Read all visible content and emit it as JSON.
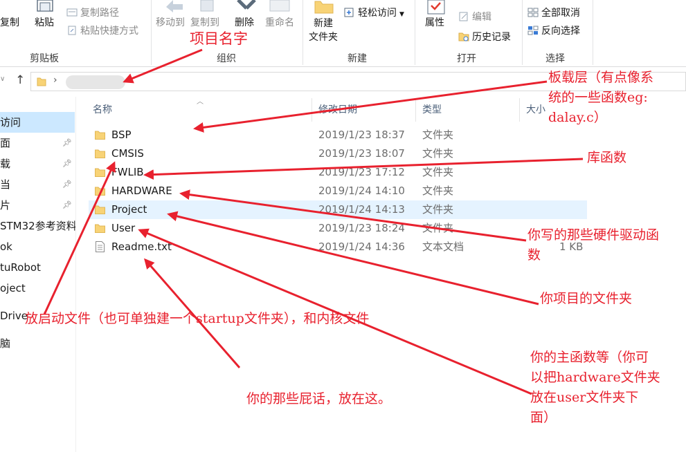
{
  "ribbon": {
    "clipboard": {
      "copy_label": "复制",
      "paste_label": "粘贴",
      "copy_path_label": "复制路径",
      "paste_shortcut_label": "粘贴快捷方式",
      "group_label": "剪贴板"
    },
    "organize": {
      "move_to_label": "移动到",
      "copy_to_label": "复制到",
      "delete_label": "删除",
      "rename_label": "重命名",
      "group_label": "组织"
    },
    "new": {
      "new_folder_label": "新建\n文件夹",
      "easy_access_label": "轻松访问",
      "group_label": "新建"
    },
    "open": {
      "properties_label": "属性",
      "edit_label": "编辑",
      "history_label": "历史记录",
      "group_label": "打开"
    },
    "select": {
      "select_none_label": "全部取消",
      "invert_selection_label": "反向选择",
      "group_label": "选择"
    }
  },
  "nav": {
    "items": [
      {
        "label": "访问",
        "selected": true,
        "pinned": false
      },
      {
        "label": "面",
        "selected": false,
        "pinned": true
      },
      {
        "label": "载",
        "selected": false,
        "pinned": true
      },
      {
        "label": "当",
        "selected": false,
        "pinned": true
      },
      {
        "label": "片",
        "selected": false,
        "pinned": true
      },
      {
        "label": "STM32参考资料",
        "selected": false,
        "pinned": false
      },
      {
        "label": "ok",
        "selected": false,
        "pinned": false
      },
      {
        "label": "tuRobot",
        "selected": false,
        "pinned": false
      },
      {
        "label": "oject",
        "selected": false,
        "pinned": false
      },
      {
        "label": "Drive",
        "selected": false,
        "pinned": false
      },
      {
        "label": "脑",
        "selected": false,
        "pinned": false
      }
    ]
  },
  "columns": {
    "name": "名称",
    "date": "修改日期",
    "type": "类型",
    "size": "大小"
  },
  "files": [
    {
      "name": "BSP",
      "date": "2019/1/23 18:37",
      "type": "文件夹",
      "size": "",
      "kind": "folder"
    },
    {
      "name": "CMSIS",
      "date": "2019/1/23 18:07",
      "type": "文件夹",
      "size": "",
      "kind": "folder"
    },
    {
      "name": "FWLIB",
      "date": "2019/1/23 17:12",
      "type": "文件夹",
      "size": "",
      "kind": "folder"
    },
    {
      "name": "HARDWARE",
      "date": "2019/1/24 14:10",
      "type": "文件夹",
      "size": "",
      "kind": "folder"
    },
    {
      "name": "Project",
      "date": "2019/1/24 14:13",
      "type": "文件夹",
      "size": "",
      "kind": "folder",
      "highlighted": true
    },
    {
      "name": "User",
      "date": "2019/1/23 18:24",
      "type": "文件夹",
      "size": "",
      "kind": "folder"
    },
    {
      "name": "Readme.txt",
      "date": "2019/1/24 14:36",
      "type": "文本文档",
      "size": "1 KB",
      "kind": "text"
    }
  ],
  "annotations": {
    "project_name": "项目名字",
    "bsp_line1": "板载层（有点像系",
    "bsp_line2": "统的一些函数eg:",
    "bsp_line3": "dalay.c）",
    "fwlib": "库函数",
    "hardware_line1": "你写的那些硬件驱动函",
    "hardware_line2": "数",
    "project": "你项目的文件夹",
    "cmsis": "放启动文件（也可单独建一个startup文件夹），和内核文件",
    "user_line1": "你的主函数等（你可",
    "user_line2": "以把hardware文件夹",
    "user_line3": "放在user文件夹下",
    "user_line4": "面）",
    "readme": "你的那些屁话，放在这。"
  },
  "colors": {
    "annotation": "#e8212e",
    "folder": "#f8d376",
    "selection": "#cce8ff",
    "row_highlight": "#e5f3ff"
  }
}
